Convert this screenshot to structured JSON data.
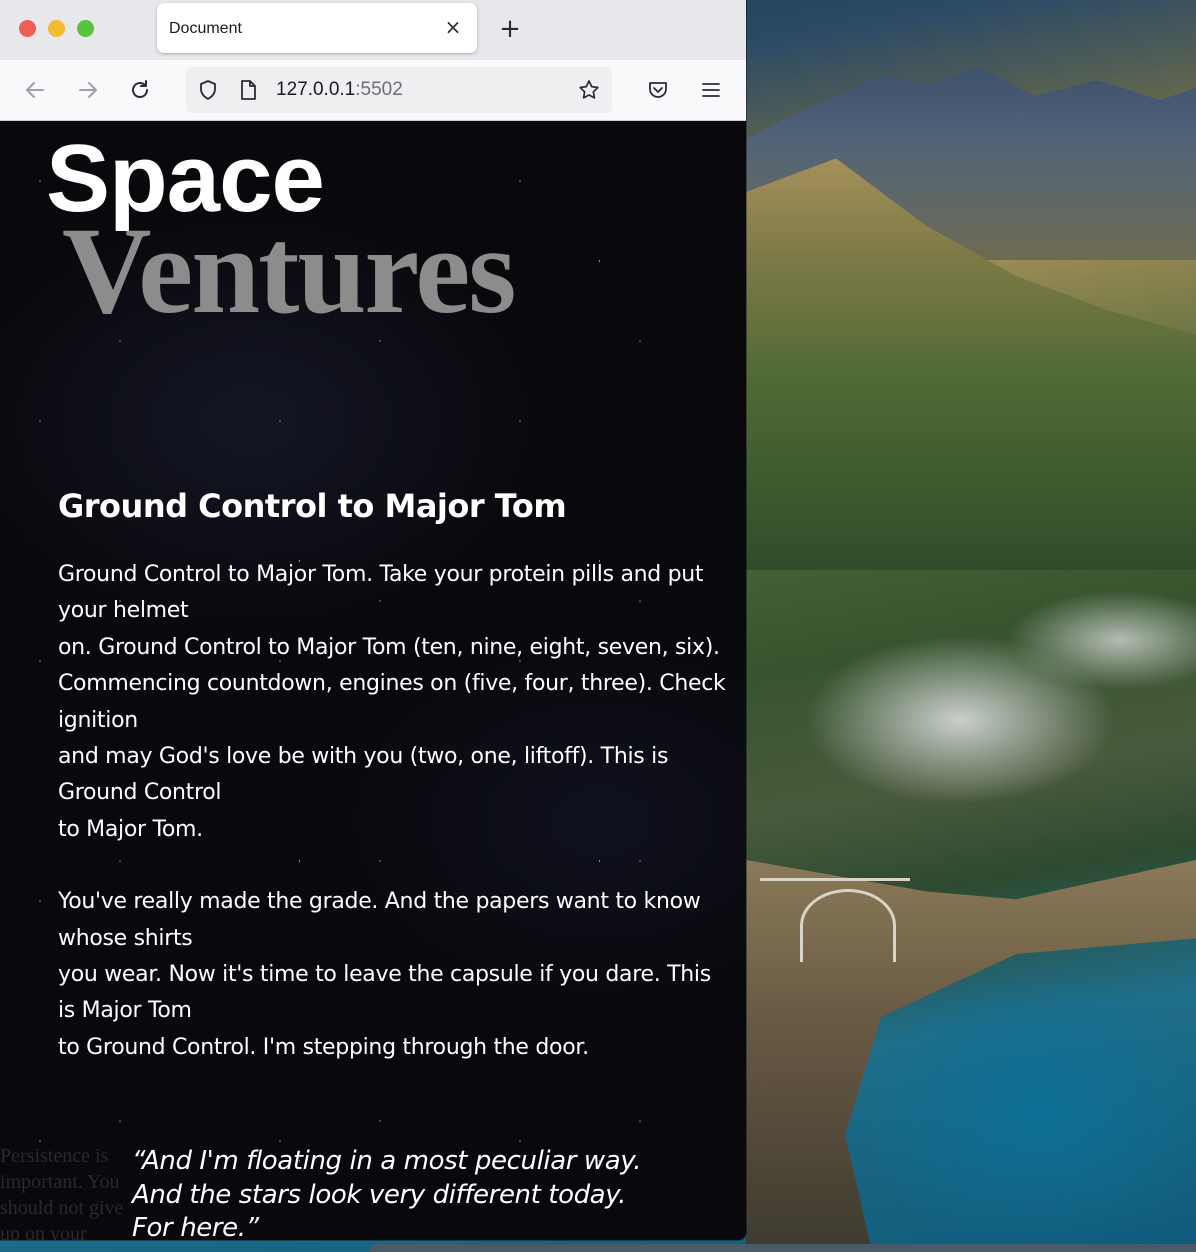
{
  "browser": {
    "tab_title": "Document",
    "tab_close_glyph": "×",
    "new_tab_glyph": "+",
    "url_host": "127.0.0.1",
    "url_port": ":5502",
    "icons": [
      "back-icon",
      "forward-icon",
      "reload-icon",
      "shield-icon",
      "page-icon",
      "bookmark-star-icon",
      "pocket-icon",
      "menu-icon"
    ]
  },
  "page": {
    "title_space": "Space",
    "title_ventures": "Ventures",
    "section_title": "Ground Control to Major Tom",
    "stanza1": [
      "Ground Control to Major Tom. Take your protein pills and put",
      "your helmet",
      "on. Ground Control to Major Tom (ten, nine, eight, seven, six).",
      "Commencing countdown, engines on (five, four, three). Check",
      "ignition",
      "and may God's love be with you (two, one, liftoff). This is",
      "Ground Control",
      "to Major Tom."
    ],
    "stanza2": [
      "You've really made the grade. And the papers want to know",
      "whose shirts",
      "you wear. Now it's time to leave the capsule if you dare. This",
      "is Major Tom",
      "to Ground Control. I'm stepping through the door."
    ],
    "overlap_lines": [
      "Persistence is",
      "important. You",
      "should not give",
      "up on your"
    ],
    "quote": [
      "“And I'm floating in a most peculiar way.",
      "And the stars look very different today.",
      "For here.”"
    ]
  },
  "colors": {
    "page_bg": "#09090d",
    "title_space": "#ffffff",
    "title_ventures": "#8c8c8c",
    "text": "#ffffff"
  }
}
